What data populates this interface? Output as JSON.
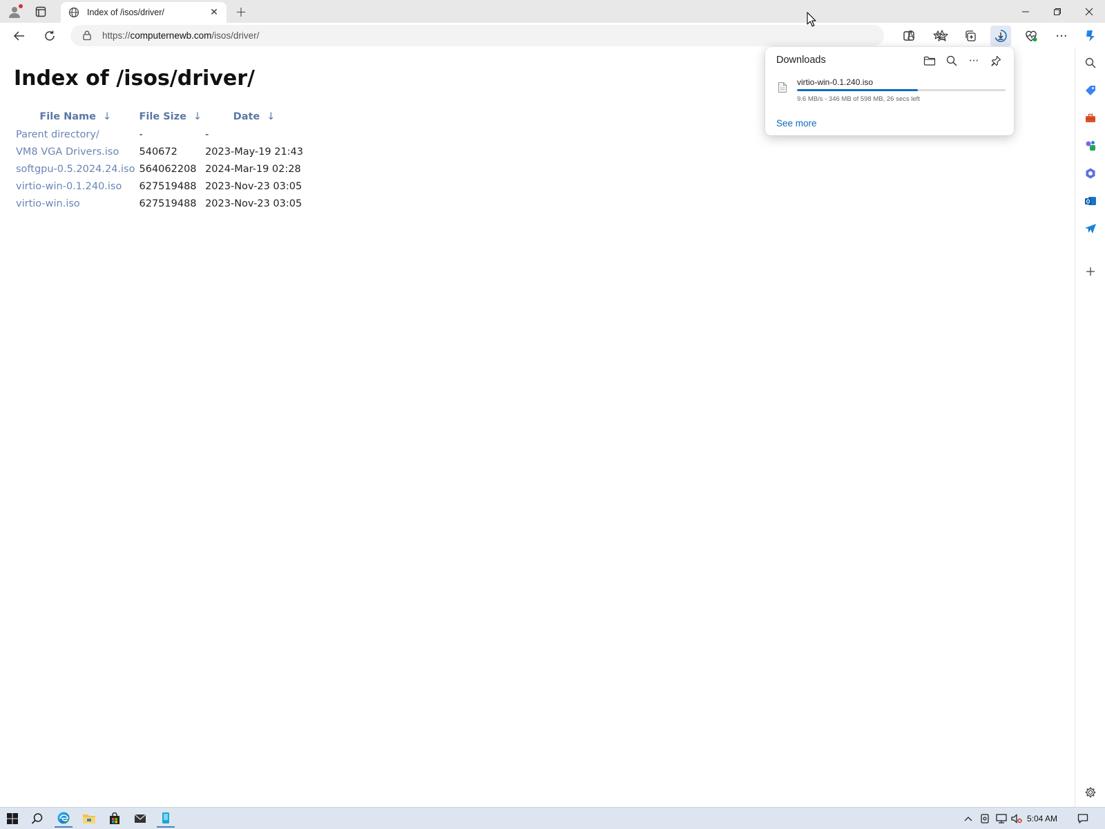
{
  "browser": {
    "tab": {
      "title": "Index of /isos/driver/"
    },
    "url": {
      "scheme": "https://",
      "host": "computernewb.com",
      "path": "/isos/driver/"
    }
  },
  "page": {
    "title": "Index of /isos/driver/",
    "columns": [
      {
        "label": "File Name",
        "arrow": "↓"
      },
      {
        "label": "File Size",
        "arrow": "↓"
      },
      {
        "label": "Date",
        "arrow": "↓"
      }
    ],
    "rows": [
      {
        "name": "Parent directory/",
        "size": "-",
        "date": "-"
      },
      {
        "name": "VM8 VGA Drivers.iso",
        "size": "540672",
        "date": "2023-May-19 21:43"
      },
      {
        "name": "softgpu-0.5.2024.24.iso",
        "size": "564062208",
        "date": "2024-Mar-19 02:28"
      },
      {
        "name": "virtio-win-0.1.240.iso",
        "size": "627519488",
        "date": "2023-Nov-23 03:05"
      },
      {
        "name": "virtio-win.iso",
        "size": "627519488",
        "date": "2023-Nov-23 03:05"
      }
    ]
  },
  "downloads": {
    "title": "Downloads",
    "item": {
      "filename": "virtio-win-0.1.240.iso",
      "status": "9.6 MB/s - 346 MB of 598 MB, 26 secs left",
      "progress": 0.58
    },
    "see_more": "See more"
  },
  "icons": {
    "read_aloud": "Ã"
  },
  "taskbar": {
    "clock": "5:04 AM"
  },
  "colors": {
    "accent": "#0f6cbd",
    "link": "#6a85b5",
    "header_link": "#5a77a8"
  }
}
